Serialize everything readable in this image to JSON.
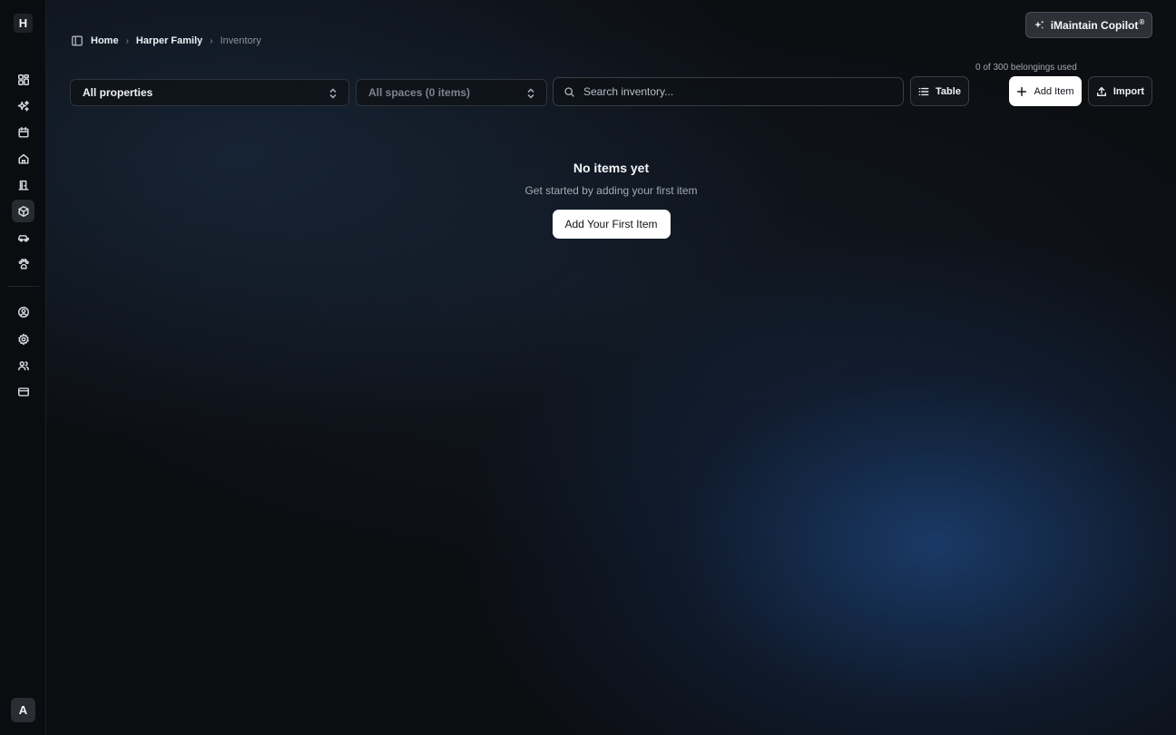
{
  "sidebar": {
    "logo_letter": "H",
    "nav_items": [
      {
        "icon": "dashboard-icon",
        "active": false
      },
      {
        "icon": "sparkles-icon",
        "active": false
      },
      {
        "icon": "calendar-icon",
        "active": false
      },
      {
        "icon": "home-icon",
        "active": false
      },
      {
        "icon": "door-icon",
        "active": false
      },
      {
        "icon": "box-icon",
        "active": true
      },
      {
        "icon": "car-icon",
        "active": false
      },
      {
        "icon": "paw-icon",
        "active": false
      }
    ],
    "secondary_items": [
      {
        "icon": "user-circle-icon"
      },
      {
        "icon": "gear-icon"
      },
      {
        "icon": "users-icon"
      },
      {
        "icon": "credit-card-icon"
      }
    ],
    "avatar_letter": "A"
  },
  "breadcrumb": {
    "items": [
      "Home",
      "Harper Family",
      "Inventory"
    ]
  },
  "copilot": {
    "label": "iMaintain Copilot",
    "badge": "®"
  },
  "usage_text": "0 of 300 belongings used",
  "filters": {
    "properties": "All properties",
    "spaces": "All spaces (0 items)"
  },
  "search": {
    "placeholder": "Search inventory..."
  },
  "toolbar": {
    "table_label": "Table",
    "add_label": "Add Item",
    "import_label": "Import"
  },
  "empty_state": {
    "title": "No items yet",
    "subtitle": "Get started by adding your first item",
    "cta": "Add Your First Item"
  },
  "colors": {
    "background": "#0c0e12",
    "accent_glow": "#1e4882",
    "primary_button": "#ffffff"
  }
}
